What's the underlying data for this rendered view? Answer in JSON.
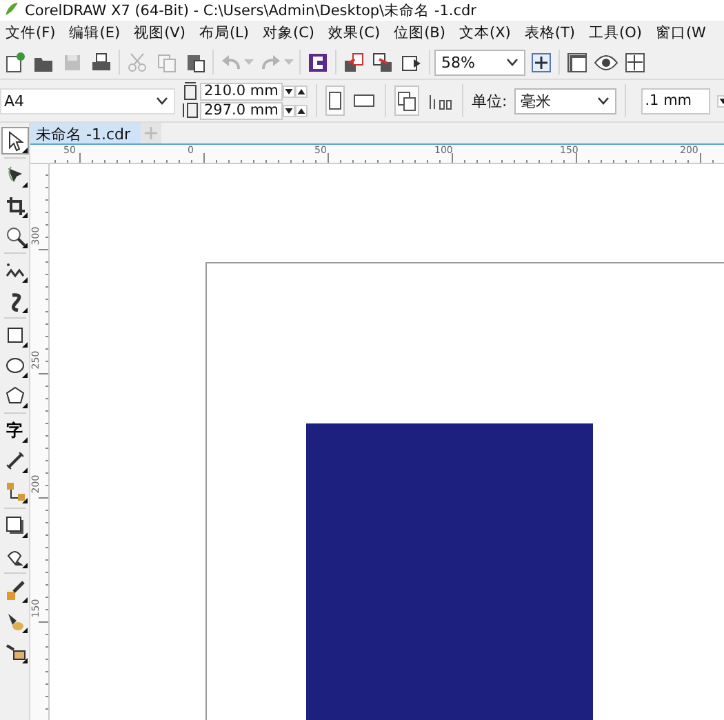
{
  "window": {
    "title": "CorelDRAW X7 (64-Bit) - C:\\Users\\Admin\\Desktop\\未命名 -1.cdr"
  },
  "menu": [
    "文件(F)",
    "编辑(E)",
    "视图(V)",
    "布局(L)",
    "对象(C)",
    "效果(C)",
    "位图(B)",
    "文本(X)",
    "表格(T)",
    "工具(O)",
    "窗口(W"
  ],
  "toolbar": [
    {
      "kind": "button",
      "disabled": false
    },
    {
      "kind": "button",
      "disabled": false
    },
    {
      "kind": "button",
      "disabled": true
    },
    {
      "kind": "button",
      "disabled": false
    },
    {
      "kind": "separator"
    },
    {
      "kind": "button",
      "disabled": true
    },
    {
      "kind": "button",
      "disabled": true
    },
    {
      "kind": "button",
      "disabled": false
    },
    {
      "kind": "separator"
    },
    {
      "kind": "dropbutton",
      "disabled": true
    },
    {
      "kind": "dropbutton",
      "disabled": true
    },
    {
      "kind": "separator"
    },
    {
      "kind": "button",
      "disabled": false
    },
    {
      "kind": "separator"
    },
    {
      "kind": "button",
      "disabled": false
    },
    {
      "kind": "button",
      "disabled": false
    },
    {
      "kind": "button",
      "disabled": false
    },
    {
      "kind": "separator"
    },
    {
      "kind": "combo",
      "value": "58%"
    },
    {
      "kind": "button",
      "disabled": false
    },
    {
      "kind": "separator"
    },
    {
      "kind": "button",
      "disabled": false
    },
    {
      "kind": "button",
      "disabled": false
    },
    {
      "kind": "button",
      "disabled": false
    }
  ],
  "property_bar": {
    "page_size": "A4",
    "width": "210.0 mm",
    "height": "297.0 mm",
    "portrait_selected": true,
    "unit_label": "单位:",
    "unit": "毫米",
    "nudge": ".1 mm"
  },
  "document_tab": {
    "label": "未命名 -1.cdr",
    "selected": true
  },
  "toolbox": [
    {
      "selected": true
    },
    {
      "selected": false
    },
    {
      "selected": false
    },
    {
      "selected": false
    },
    {
      "selected": false
    },
    {
      "selected": false
    },
    {
      "selected": false
    },
    {
      "selected": false
    },
    {
      "selected": false
    },
    {
      "selected": false,
      "label": "字"
    },
    {
      "selected": false
    },
    {
      "selected": false
    },
    {
      "selected": false
    },
    {
      "selected": false
    },
    {
      "selected": false
    },
    {
      "selected": false
    },
    {
      "selected": false
    }
  ],
  "horizontal_ruler": [
    "50",
    "0",
    "50",
    "100",
    "150",
    "200"
  ],
  "vertical_ruler": [
    "300",
    "250",
    "200",
    "150"
  ]
}
